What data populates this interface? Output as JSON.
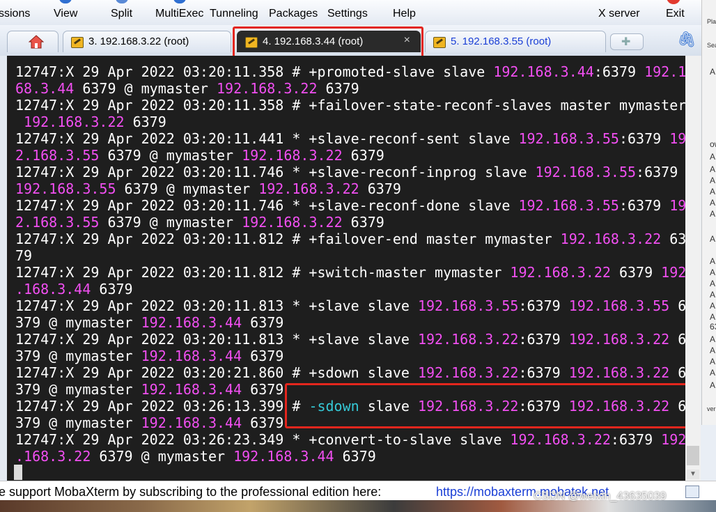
{
  "menu": {
    "items": [
      "ssions",
      "View",
      "Split",
      "MultiExec",
      "Tunneling",
      "Packages",
      "Settings",
      "Help",
      "X server",
      "Exit"
    ]
  },
  "tabs": [
    {
      "label": "3. 192.168.3.22 (root)",
      "active": false
    },
    {
      "label": "4. 192.168.3.44 (root)",
      "active": true,
      "close": "×"
    },
    {
      "label": "5. 192.168.3.55 (root)",
      "active": false
    }
  ],
  "terminal": {
    "lines": [
      [
        {
          "t": "12747:X 29 Apr 2022 03:20:11.358 # +promoted-slave slave "
        },
        {
          "t": "192.168.3.44",
          "c": "ip"
        },
        {
          "t": ":6379 "
        },
        {
          "t": "192.1",
          "c": "ip"
        }
      ],
      [
        {
          "t": "68.3.44",
          "c": "ip"
        },
        {
          "t": " 6379 @ mymaster "
        },
        {
          "t": "192.168.3.22",
          "c": "ip"
        },
        {
          "t": " 6379"
        }
      ],
      [
        {
          "t": "12747:X 29 Apr 2022 03:20:11.358 # +failover-state-reconf-slaves master mymaster"
        }
      ],
      [
        {
          "t": " "
        },
        {
          "t": "192.168.3.22",
          "c": "ip"
        },
        {
          "t": " 6379"
        }
      ],
      [
        {
          "t": "12747:X 29 Apr 2022 03:20:11.441 * +slave-reconf-sent slave "
        },
        {
          "t": "192.168.3.55",
          "c": "ip"
        },
        {
          "t": ":6379 "
        },
        {
          "t": "19",
          "c": "ip"
        }
      ],
      [
        {
          "t": "2.168.3.55",
          "c": "ip"
        },
        {
          "t": " 6379 @ mymaster "
        },
        {
          "t": "192.168.3.22",
          "c": "ip"
        },
        {
          "t": " 6379"
        }
      ],
      [
        {
          "t": "12747:X 29 Apr 2022 03:20:11.746 * +slave-reconf-inprog slave "
        },
        {
          "t": "192.168.3.55",
          "c": "ip"
        },
        {
          "t": ":6379"
        }
      ],
      [
        {
          "t": "192.168.3.55",
          "c": "ip"
        },
        {
          "t": " 6379 @ mymaster "
        },
        {
          "t": "192.168.3.22",
          "c": "ip"
        },
        {
          "t": " 6379"
        }
      ],
      [
        {
          "t": "12747:X 29 Apr 2022 03:20:11.746 * +slave-reconf-done slave "
        },
        {
          "t": "192.168.3.55",
          "c": "ip"
        },
        {
          "t": ":6379 "
        },
        {
          "t": "19",
          "c": "ip"
        }
      ],
      [
        {
          "t": "2.168.3.55",
          "c": "ip"
        },
        {
          "t": " 6379 @ mymaster "
        },
        {
          "t": "192.168.3.22",
          "c": "ip"
        },
        {
          "t": " 6379"
        }
      ],
      [
        {
          "t": "12747:X 29 Apr 2022 03:20:11.812 # +failover-end master mymaster "
        },
        {
          "t": "192.168.3.22",
          "c": "ip"
        },
        {
          "t": " 63"
        }
      ],
      [
        {
          "t": "79"
        }
      ],
      [
        {
          "t": "12747:X 29 Apr 2022 03:20:11.812 # +switch-master mymaster "
        },
        {
          "t": "192.168.3.22",
          "c": "ip"
        },
        {
          "t": " 6379 "
        },
        {
          "t": "192",
          "c": "ip"
        }
      ],
      [
        {
          "t": ".168.3.44",
          "c": "ip"
        },
        {
          "t": " 6379"
        }
      ],
      [
        {
          "t": "12747:X 29 Apr 2022 03:20:11.813 * +slave slave "
        },
        {
          "t": "192.168.3.55",
          "c": "ip"
        },
        {
          "t": ":6379 "
        },
        {
          "t": "192.168.3.55",
          "c": "ip"
        },
        {
          "t": " 6"
        }
      ],
      [
        {
          "t": "379 @ mymaster "
        },
        {
          "t": "192.168.3.44",
          "c": "ip"
        },
        {
          "t": " 6379"
        }
      ],
      [
        {
          "t": "12747:X 29 Apr 2022 03:20:11.813 * +slave slave "
        },
        {
          "t": "192.168.3.22",
          "c": "ip"
        },
        {
          "t": ":6379 "
        },
        {
          "t": "192.168.3.22",
          "c": "ip"
        },
        {
          "t": " 6"
        }
      ],
      [
        {
          "t": "379 @ mymaster "
        },
        {
          "t": "192.168.3.44",
          "c": "ip"
        },
        {
          "t": " 6379"
        }
      ],
      [
        {
          "t": "12747:X 29 Apr 2022 03:20:21.860 # +sdown slave "
        },
        {
          "t": "192.168.3.22",
          "c": "ip"
        },
        {
          "t": ":6379 "
        },
        {
          "t": "192.168.3.22",
          "c": "ip"
        },
        {
          "t": " 6"
        }
      ],
      [
        {
          "t": "379 @ mymaster "
        },
        {
          "t": "192.168.3.44",
          "c": "ip"
        },
        {
          "t": " 6379"
        }
      ],
      [
        {
          "t": "12747:X 29 Apr 2022 03:26:13.399 # "
        },
        {
          "t": "-sdown",
          "c": "cy"
        },
        {
          "t": " slave "
        },
        {
          "t": "192.168.3.22",
          "c": "ip"
        },
        {
          "t": ":6379 "
        },
        {
          "t": "192.168.3.22",
          "c": "ip"
        },
        {
          "t": " 6"
        }
      ],
      [
        {
          "t": "379 @ mymaster "
        },
        {
          "t": "192.168.3.44",
          "c": "ip"
        },
        {
          "t": " 6379"
        }
      ],
      [
        {
          "t": "12747:X 29 Apr 2022 03:26:23.349 * +convert-to-slave slave "
        },
        {
          "t": "192.168.3.22",
          "c": "ip"
        },
        {
          "t": ":6379 "
        },
        {
          "t": "192",
          "c": "ip"
        }
      ],
      [
        {
          "t": ".168.3.22",
          "c": "ip"
        },
        {
          "t": " 6379 @ mymaster "
        },
        {
          "t": "192.168.3.44",
          "c": "ip"
        },
        {
          "t": " 6379"
        }
      ]
    ]
  },
  "ad_bar": {
    "text": "e support MobaXterm by subscribing to the professional edition here:",
    "link": "https://mobaxterm.mobatek.net"
  },
  "watermark": "CSDN @weixin_43635039",
  "right_panel": {
    "chars": [
      "Plac",
      "Sea",
      "A",
      "ow",
      "A",
      "A",
      "A",
      "A",
      "A",
      "A",
      "A",
      "A",
      "A",
      "A",
      "A",
      "A",
      "A",
      "63",
      "A",
      "A",
      "A",
      "A",
      "A",
      "ver2"
    ]
  },
  "colors": {
    "terminal_bg": "#1e1e1e",
    "text": "#ffffff",
    "ip_highlight": "#f24ff2",
    "keyword_cyan": "#35c9d7",
    "annotation_red": "#e3261d"
  },
  "icons": {
    "home": "home-icon",
    "wrench": "wrench-icon",
    "new_tab": "plus-icon",
    "attach": "paperclip-icon"
  }
}
